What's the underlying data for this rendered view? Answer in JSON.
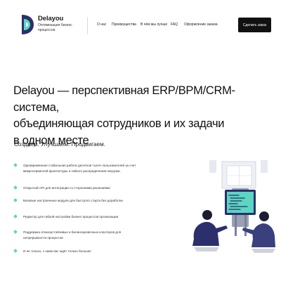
{
  "brand": {
    "name": "Delayou",
    "tagline": "Оптимизация бизнес процессов",
    "colors": {
      "navy": "#2b2f6b",
      "teal": "#5cd6c0",
      "dark": "#111111"
    }
  },
  "nav": {
    "items": [
      "О нас",
      "Преимущества",
      "В чём мы лучше",
      "FAQ",
      "Оформление заказа"
    ],
    "cta_label": "Сделать заказ"
  },
  "hero": {
    "title_lines": [
      "Delayou — перспективная ERP/BPM/CRM-система,",
      "объединяющая сотрудников и их задачи",
      "в одном месте"
    ],
    "subtitle": "Создаём. Улучшаем. Продвигаем."
  },
  "features": [
    "Одновременная стабильная работа десятков тысяч пользователей за счет микросервисной архитектуры и гибкого распределения нагрузки",
    "Открытый API для интеграции со сторонними решениями",
    "Базовые настроенные модули для быстрого старта без доработки",
    "Редактор для гибкой настройки бизнес-процессов организации",
    "Поддержка отказоустойчивых и балансировочных кластеров для непрерывности процессов",
    "И не только, с нами вас ждёт только больше!"
  ]
}
